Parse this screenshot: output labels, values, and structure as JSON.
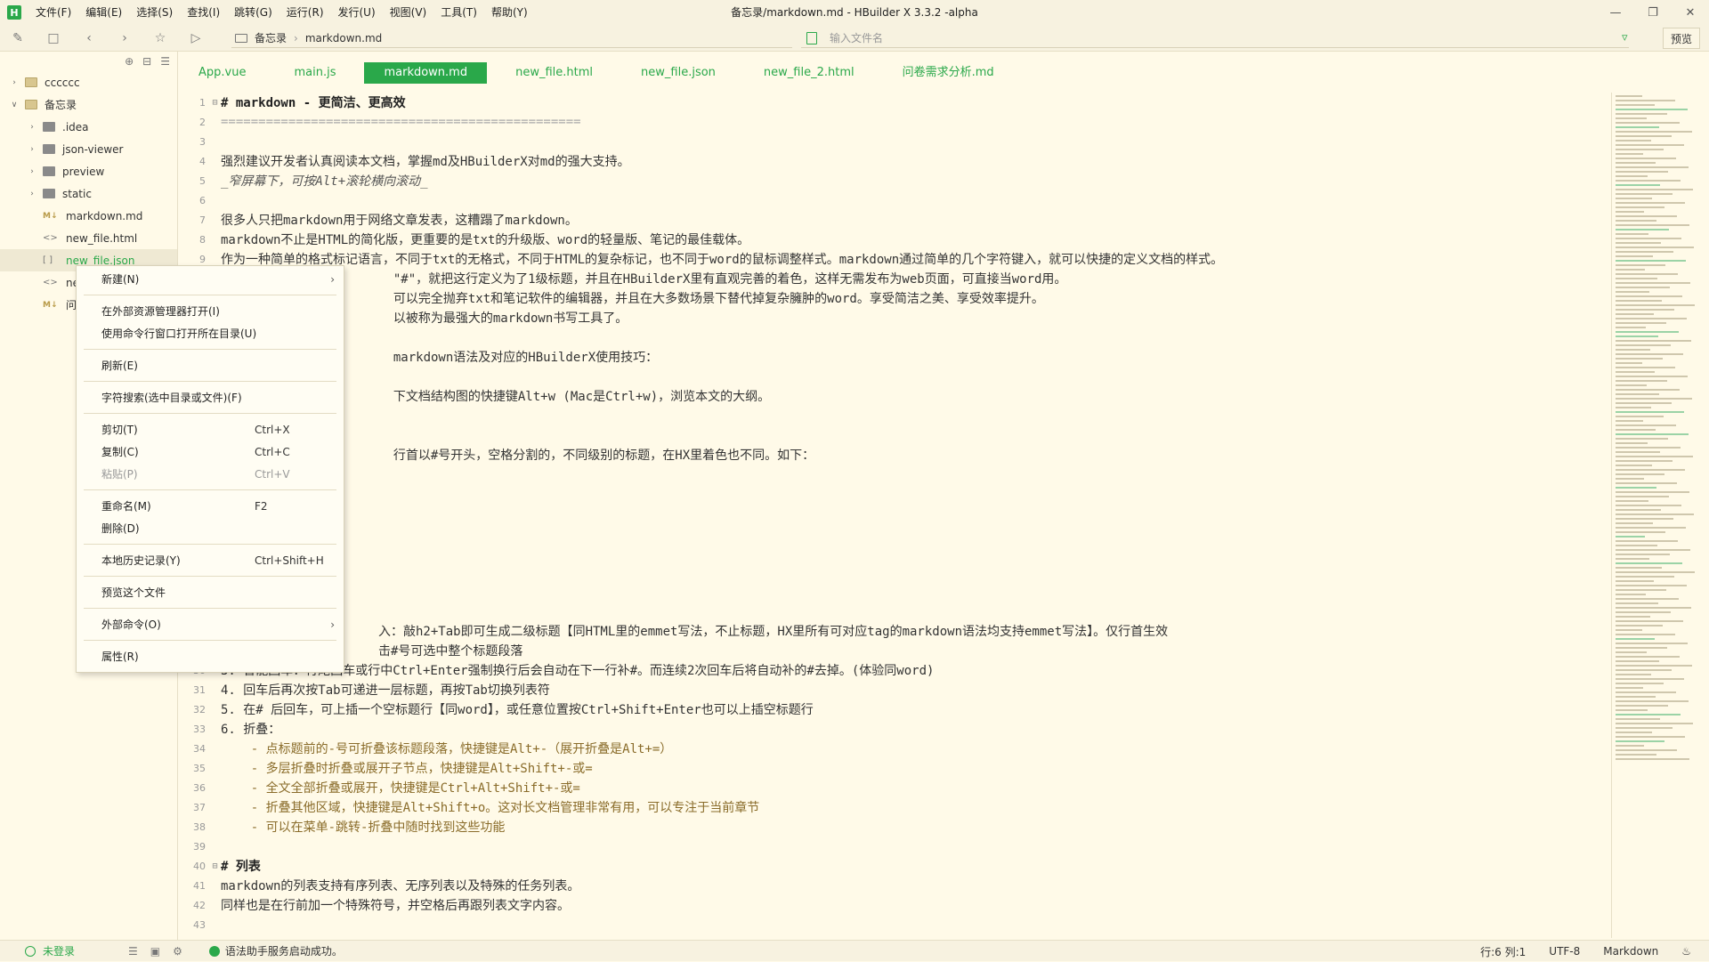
{
  "app": {
    "title": "备忘录/markdown.md - HBuilder X 3.3.2 -alpha",
    "logo": "H"
  },
  "menu": [
    "文件(F)",
    "编辑(E)",
    "选择(S)",
    "查找(I)",
    "跳转(G)",
    "运行(R)",
    "发行(U)",
    "视图(V)",
    "工具(T)",
    "帮助(Y)"
  ],
  "window_controls": [
    "minimize-icon",
    "restore-icon",
    "close-icon"
  ],
  "toolbar": {
    "breadcrumb": [
      "备忘录",
      "markdown.md"
    ],
    "search_placeholder": "输入文件名",
    "preview_label": "预览"
  },
  "sidebar": {
    "tree": [
      {
        "label": "cccccc",
        "type": "project",
        "expanded": false
      },
      {
        "label": "备忘录",
        "type": "project",
        "expanded": true
      },
      {
        "label": ".idea",
        "type": "folder"
      },
      {
        "label": "json-viewer",
        "type": "folder"
      },
      {
        "label": "preview",
        "type": "folder"
      },
      {
        "label": "static",
        "type": "folder"
      },
      {
        "label": "markdown.md",
        "type": "md"
      },
      {
        "label": "new_file.html",
        "type": "html"
      },
      {
        "label": "new_file.json",
        "type": "json",
        "selected": true
      },
      {
        "label": "nev",
        "type": "html"
      },
      {
        "label": "问卷",
        "type": "md"
      }
    ]
  },
  "tabs": [
    "App.vue",
    "main.js",
    "markdown.md",
    "new_file.html",
    "new_file.json",
    "new_file_2.html",
    "问卷需求分析.md"
  ],
  "active_tab": "markdown.md",
  "editor": {
    "lines": [
      {
        "n": "1",
        "text": "# markdown - 更简洁、更高效",
        "style": "h1",
        "fold": "⊟"
      },
      {
        "n": "2",
        "text": "================================================",
        "style": "sep"
      },
      {
        "n": "3",
        "text": "",
        "style": ""
      },
      {
        "n": "4",
        "text": "强烈建议开发者认真阅读本文档，掌握md及HBuilderX对md的强大支持。",
        "style": ""
      },
      {
        "n": "5",
        "text": "_窄屏幕下，可按Alt+滚轮横向滚动_",
        "style": "em"
      },
      {
        "n": "6",
        "text": "",
        "style": ""
      },
      {
        "n": "7",
        "text": "很多人只把markdown用于网络文章发表，这糟蹋了markdown。",
        "style": ""
      },
      {
        "n": "8",
        "text": "markdown不止是HTML的简化版，更重要的是txt的升级版、word的轻量版、笔记的最佳载体。",
        "style": ""
      },
      {
        "n": "9",
        "text": "作为一种简单的格式标记语言，不同于txt的无格式，不同于HTML的复杂标记，也不同于word的鼠标调整样式。markdown通过简单的几个字符键入，就可以快捷的定义文档的样式。",
        "style": ""
      },
      {
        "n": "",
        "text": "                       \"#\"，就把这行定义为了1级标题，并且在HBuilderX里有直观完善的着色，这样无需发布为web页面，可直接当word用。",
        "style": ""
      },
      {
        "n": "",
        "text": "                       可以完全抛弃txt和笔记软件的编辑器，并且在大多数场景下替代掉复杂臃肿的word。享受简洁之美、享受效率提升。",
        "style": ""
      },
      {
        "n": "",
        "text": "                       以被称为最强大的markdown书写工具了。",
        "style": ""
      },
      {
        "n": "",
        "text": "",
        "style": ""
      },
      {
        "n": "",
        "text": "                       markdown语法及对应的HBuilderX使用技巧：",
        "style": ""
      },
      {
        "n": "",
        "text": "",
        "style": ""
      },
      {
        "n": "",
        "text": "                       下文档结构图的快捷键Alt+w (Mac是Ctrl+w)，浏览本文的大纲。",
        "style": ""
      },
      {
        "n": "",
        "text": "",
        "style": ""
      },
      {
        "n": "",
        "text": "",
        "style": ""
      },
      {
        "n": "",
        "text": "                       行首以#号开头，空格分割的，不同级别的标题，在HX里着色也不同。如下：",
        "style": ""
      },
      {
        "n": "",
        "text": "",
        "style": ""
      },
      {
        "n": "",
        "text": "",
        "style": ""
      },
      {
        "n": "",
        "text": "",
        "style": ""
      },
      {
        "n": "",
        "text": "",
        "style": ""
      },
      {
        "n": "",
        "text": "",
        "style": ""
      },
      {
        "n": "",
        "text": "",
        "style": ""
      },
      {
        "n": "",
        "text": "",
        "style": ""
      },
      {
        "n": "",
        "text": "",
        "style": ""
      },
      {
        "n": "",
        "text": "                     入：敲h2+Tab即可生成二级标题【同HTML里的emmet写法，不止标题，HX里所有可对应tag的markdown语法均支持emmet写法】。仅行首生效",
        "style": ""
      },
      {
        "n": "",
        "text": "                     击#号可选中整个标题段落",
        "style": ""
      },
      {
        "n": "30",
        "text": "3. 智能回车：行尾回车或行中Ctrl+Enter强制换行后会自动在下一行补#。而连续2次回车后将自动补的#去掉。(体验同word)",
        "style": ""
      },
      {
        "n": "31",
        "text": "4. 回车后再次按Tab可递进一层标题，再按Tab切换列表符",
        "style": ""
      },
      {
        "n": "32",
        "text": "5. 在# 后回车，可上插一个空标题行【同word】，或任意位置按Ctrl+Shift+Enter也可以上插空标题行",
        "style": ""
      },
      {
        "n": "33",
        "text": "6. 折叠：",
        "style": ""
      },
      {
        "n": "34",
        "text": "    - 点标题前的-号可折叠该标题段落，快捷键是Alt+-（展开折叠是Alt+=）",
        "style": "sub"
      },
      {
        "n": "35",
        "text": "    - 多层折叠时折叠或展开子节点，快捷键是Alt+Shift+-或=",
        "style": "sub"
      },
      {
        "n": "36",
        "text": "    - 全文全部折叠或展开，快捷键是Ctrl+Alt+Shift+-或=",
        "style": "sub"
      },
      {
        "n": "37",
        "text": "    - 折叠其他区域，快捷键是Alt+Shift+o。这对长文档管理非常有用，可以专注于当前章节",
        "style": "sub"
      },
      {
        "n": "38",
        "text": "    - 可以在菜单-跳转-折叠中随时找到这些功能",
        "style": "sub"
      },
      {
        "n": "39",
        "text": "",
        "style": ""
      },
      {
        "n": "40",
        "text": "# 列表",
        "style": "h1",
        "fold": "⊟"
      },
      {
        "n": "41",
        "text": "markdown的列表支持有序列表、无序列表以及特殊的任务列表。",
        "style": ""
      },
      {
        "n": "42",
        "text": "同样也是在行前加一个特殊符号，并空格后再跟列表文字内容。",
        "style": ""
      },
      {
        "n": "43",
        "text": "",
        "style": ""
      }
    ]
  },
  "context_menu": {
    "items": [
      {
        "label": "新建(N)",
        "shortcut": "",
        "submenu": true
      },
      {
        "sep": true
      },
      {
        "label": "在外部资源管理器打开(I)",
        "shortcut": ""
      },
      {
        "label": "使用命令行窗口打开所在目录(U)",
        "shortcut": ""
      },
      {
        "sep": true
      },
      {
        "label": "刷新(E)",
        "shortcut": ""
      },
      {
        "sep": true
      },
      {
        "label": "字符搜索(选中目录或文件)(F)",
        "shortcut": ""
      },
      {
        "sep": true
      },
      {
        "label": "剪切(T)",
        "shortcut": "Ctrl+X"
      },
      {
        "label": "复制(C)",
        "shortcut": "Ctrl+C"
      },
      {
        "label": "粘贴(P)",
        "shortcut": "Ctrl+V",
        "disabled": true
      },
      {
        "sep": true
      },
      {
        "label": "重命名(M)",
        "shortcut": "F2"
      },
      {
        "label": "删除(D)",
        "shortcut": ""
      },
      {
        "sep": true
      },
      {
        "label": "本地历史记录(Y)",
        "shortcut": "Ctrl+Shift+H"
      },
      {
        "sep": true
      },
      {
        "label": "预览这个文件",
        "shortcut": ""
      },
      {
        "sep": true
      },
      {
        "label": "外部命令(O)",
        "shortcut": "",
        "submenu": true
      },
      {
        "sep": true
      },
      {
        "label": "属性(R)",
        "shortcut": ""
      }
    ]
  },
  "statusbar": {
    "login": "未登录",
    "message": "语法助手服务启动成功。",
    "position": "行:6  列:1",
    "encoding": "UTF-8",
    "language": "Markdown"
  },
  "colors": {
    "accent": "#2aa84a",
    "background": "#fffae8"
  }
}
